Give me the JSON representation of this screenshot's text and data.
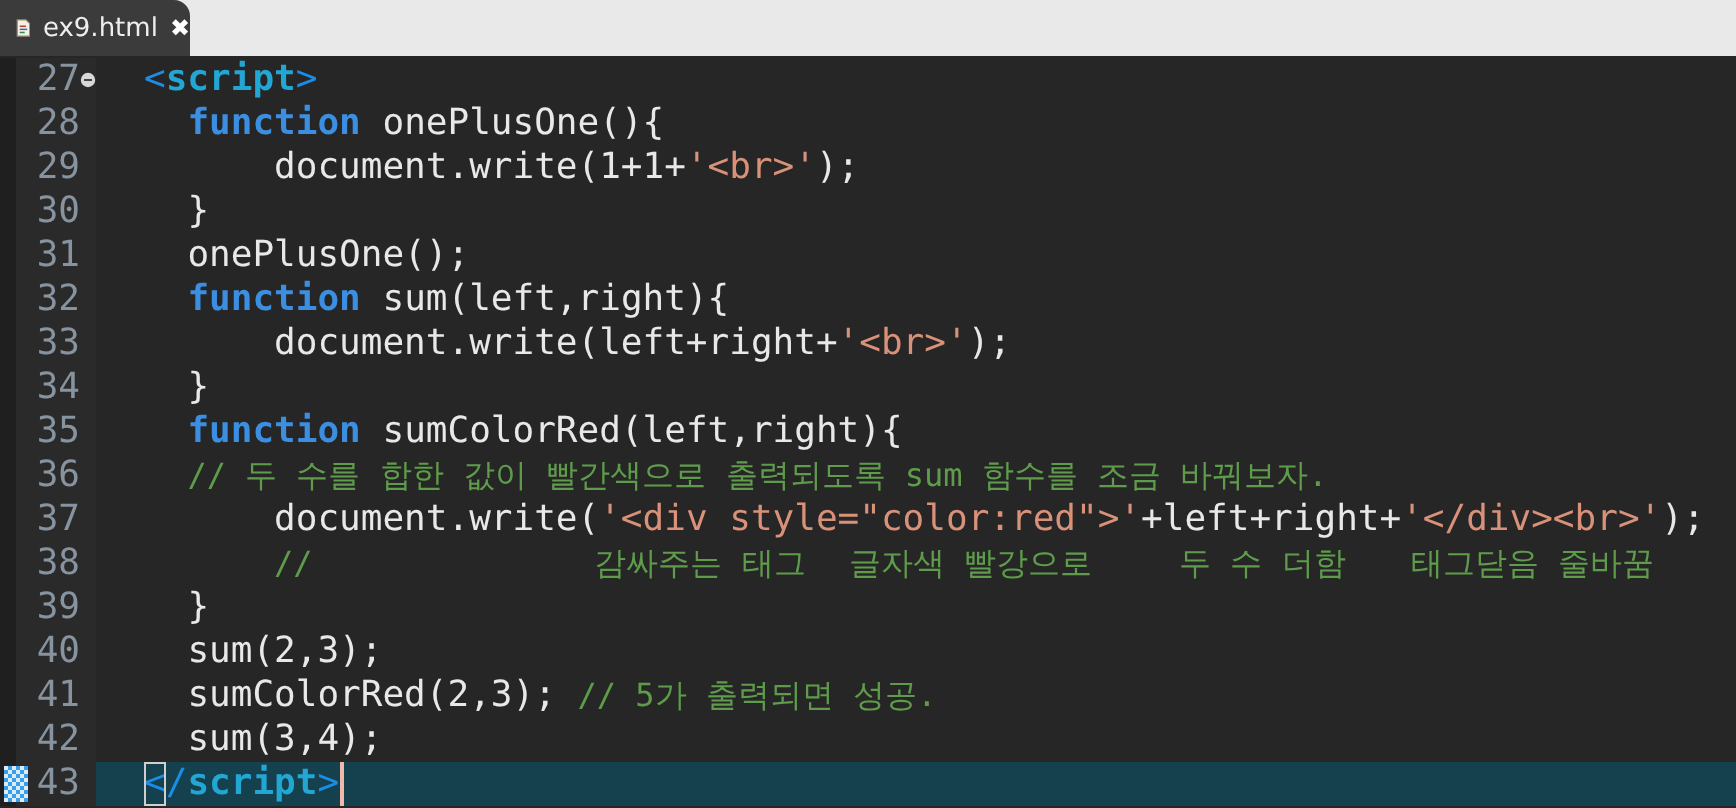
{
  "tab": {
    "label": "ex9.html",
    "selected": true,
    "close": "✖"
  },
  "lines": [
    {
      "number": "27",
      "fold": true,
      "current": false,
      "marked": false,
      "tokens": [
        {
          "kind": "bracket",
          "text": "<"
        },
        {
          "kind": "tagname",
          "text": "script"
        },
        {
          "kind": "bracket",
          "text": ">"
        }
      ]
    },
    {
      "number": "28",
      "fold": false,
      "current": false,
      "marked": false,
      "tokens": [
        {
          "kind": "keyword",
          "text": "  function"
        },
        {
          "kind": "plain",
          "text": " onePlusOne(){"
        }
      ]
    },
    {
      "number": "29",
      "fold": false,
      "current": false,
      "marked": false,
      "tokens": [
        {
          "kind": "plain",
          "text": "      document.write(1+1+"
        },
        {
          "kind": "string",
          "text": "'<br>'"
        },
        {
          "kind": "plain",
          "text": ");"
        }
      ]
    },
    {
      "number": "30",
      "fold": false,
      "current": false,
      "marked": false,
      "tokens": [
        {
          "kind": "plain",
          "text": "  }"
        }
      ]
    },
    {
      "number": "31",
      "fold": false,
      "current": false,
      "marked": false,
      "tokens": [
        {
          "kind": "plain",
          "text": "  onePlusOne();"
        }
      ]
    },
    {
      "number": "32",
      "fold": false,
      "current": false,
      "marked": false,
      "tokens": [
        {
          "kind": "keyword",
          "text": "  function"
        },
        {
          "kind": "plain",
          "text": " sum(left,right){"
        }
      ]
    },
    {
      "number": "33",
      "fold": false,
      "current": false,
      "marked": false,
      "tokens": [
        {
          "kind": "plain",
          "text": "      document.write(left+right+"
        },
        {
          "kind": "string",
          "text": "'<br>'"
        },
        {
          "kind": "plain",
          "text": ");"
        }
      ]
    },
    {
      "number": "34",
      "fold": false,
      "current": false,
      "marked": false,
      "tokens": [
        {
          "kind": "plain",
          "text": "  }"
        }
      ]
    },
    {
      "number": "35",
      "fold": false,
      "current": false,
      "marked": false,
      "tokens": [
        {
          "kind": "keyword",
          "text": "  function"
        },
        {
          "kind": "plain",
          "text": " sumColorRed(left,right){"
        }
      ]
    },
    {
      "number": "36",
      "fold": false,
      "current": false,
      "marked": false,
      "tokens": [
        {
          "kind": "comment",
          "text": "  // 두 수를 합한 값이 빨간색으로 출력되도록 sum 함수를 조금 바꿔보자."
        }
      ]
    },
    {
      "number": "37",
      "fold": false,
      "current": false,
      "marked": false,
      "tokens": [
        {
          "kind": "plain",
          "text": "      document.write("
        },
        {
          "kind": "string",
          "text": "'<div style=\"color:red\">'"
        },
        {
          "kind": "plain",
          "text": "+left+right+"
        },
        {
          "kind": "string",
          "text": "'</div><br>'"
        },
        {
          "kind": "plain",
          "text": ");"
        }
      ]
    },
    {
      "number": "38",
      "fold": false,
      "current": false,
      "marked": false,
      "tokens": [
        {
          "kind": "comment",
          "text": "      //"
        },
        {
          "kind": "comment",
          "text": "             감싸주는 태그"
        },
        {
          "kind": "comment",
          "text": "  글자색 빨강으로"
        },
        {
          "kind": "comment",
          "text": "    두 수 더함"
        },
        {
          "kind": "comment",
          "text": "   태그닫음 줄바꿈"
        }
      ]
    },
    {
      "number": "39",
      "fold": false,
      "current": false,
      "marked": false,
      "tokens": [
        {
          "kind": "plain",
          "text": "  }"
        }
      ]
    },
    {
      "number": "40",
      "fold": false,
      "current": false,
      "marked": false,
      "tokens": [
        {
          "kind": "plain",
          "text": "  sum(2,3);"
        }
      ]
    },
    {
      "number": "41",
      "fold": false,
      "current": false,
      "marked": false,
      "tokens": [
        {
          "kind": "plain",
          "text": "  sumColorRed(2,3);"
        },
        {
          "kind": "comment",
          "text": " // 5가 출력되면 성공."
        }
      ]
    },
    {
      "number": "42",
      "fold": false,
      "current": false,
      "marked": false,
      "tokens": [
        {
          "kind": "plain",
          "text": "  sum(3,4);"
        }
      ]
    },
    {
      "number": "43",
      "fold": false,
      "current": true,
      "marked": true,
      "tokens": [
        {
          "kind": "bracket",
          "text": "<",
          "matched": true
        },
        {
          "kind": "bracket",
          "text": "/"
        },
        {
          "kind": "tagname",
          "text": "script"
        },
        {
          "kind": "bracket",
          "text": ">"
        }
      ]
    }
  ]
}
